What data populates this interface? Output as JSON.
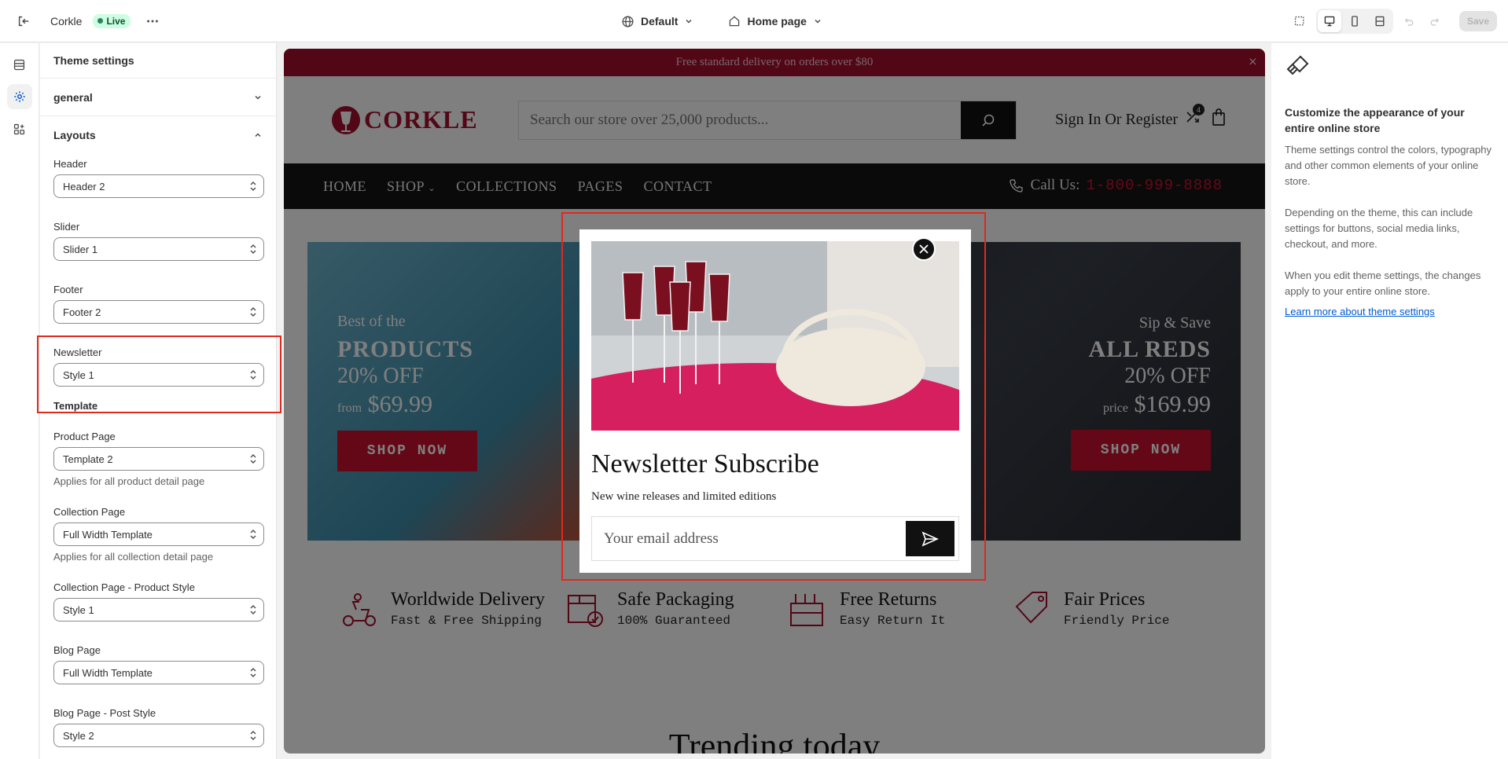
{
  "topbar": {
    "store_name": "Corkle",
    "status": "Live",
    "theme_picker": "Default",
    "page_picker": "Home page",
    "save_label": "Save"
  },
  "panel": {
    "title": "Theme settings",
    "sections": {
      "general": "general",
      "layouts": "Layouts",
      "template": "Template"
    },
    "fields": {
      "header": {
        "label": "Header",
        "value": "Header 2"
      },
      "slider": {
        "label": "Slider",
        "value": "Slider 1"
      },
      "footer": {
        "label": "Footer",
        "value": "Footer 2"
      },
      "newsletter": {
        "label": "Newsletter",
        "value": "Style 1"
      },
      "product_page": {
        "label": "Product Page",
        "value": "Template 2",
        "help": "Applies for all product detail page"
      },
      "collection_page": {
        "label": "Collection Page",
        "value": "Full Width Template",
        "help": "Applies for all collection detail page"
      },
      "collection_product_style": {
        "label": "Collection Page - Product Style",
        "value": "Style 1"
      },
      "blog_page": {
        "label": "Blog Page",
        "value": "Full Width Template"
      },
      "blog_post_style": {
        "label": "Blog Page - Post Style",
        "value": "Style 2"
      }
    }
  },
  "store": {
    "announcement": "Free standard delivery on orders over $80",
    "logo": "CORKLE",
    "search_placeholder": "Search our store over 25,000 products...",
    "account": "Sign In Or Register",
    "cart_count": "4",
    "nav": [
      "HOME",
      "SHOP",
      "COLLECTIONS",
      "PAGES",
      "CONTACT"
    ],
    "call_label": "Call Us:",
    "call_number": "1-800-999-8888",
    "banner_left": {
      "kicker": "Best of the",
      "headline": "PRODUCTS",
      "offer": "20% OFF",
      "from": "from",
      "price": "$69.99",
      "cta": "SHOP NOW"
    },
    "banner_right": {
      "kicker": "Sip & Save",
      "headline": "ALL REDS",
      "offer": "20% OFF",
      "from": "price",
      "price": "$169.99",
      "cta": "SHOP NOW"
    },
    "features": [
      {
        "title": "Worldwide Delivery",
        "sub": "Fast & Free Shipping"
      },
      {
        "title": "Safe Packaging",
        "sub": "100% Guaranteed"
      },
      {
        "title": "Free Returns",
        "sub": "Easy Return It"
      },
      {
        "title": "Fair Prices",
        "sub": "Friendly Price"
      }
    ],
    "trending": "Trending today"
  },
  "modal": {
    "title": "Newsletter Subscribe",
    "subtitle": "New wine releases and limited editions",
    "email_placeholder": "Your email address"
  },
  "info": {
    "title": "Customize the appearance of your entire online store",
    "p1": "Theme settings control the colors, typography and other common elements of your online store.",
    "p2": "Depending on the theme, this can include settings for buttons, social media links, checkout, and more.",
    "p3": "When you edit theme settings, the changes apply to your entire online store.",
    "link": "Learn more about theme settings"
  },
  "colors": {
    "brand": "#a50f2c",
    "accent_link": "#005bd3",
    "highlight": "#e0291d",
    "live_badge": "#cdfee1"
  }
}
